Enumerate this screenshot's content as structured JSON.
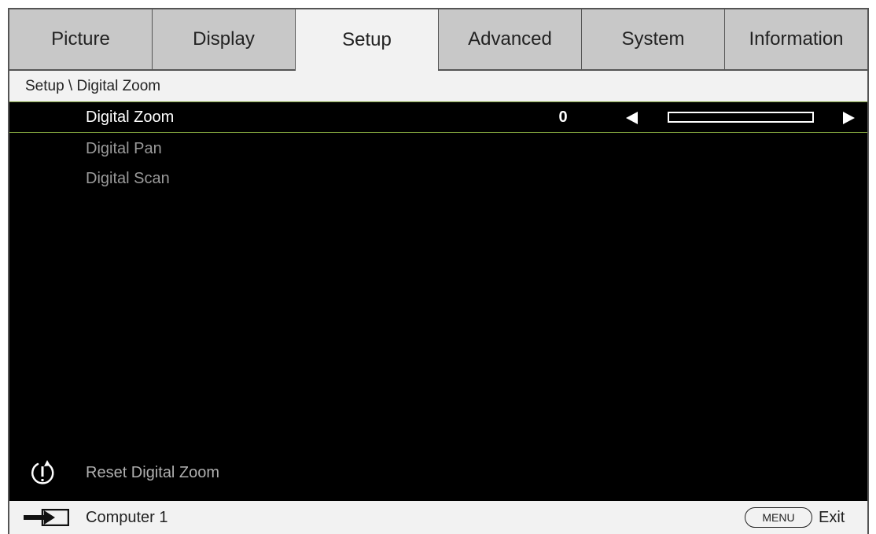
{
  "tabs": [
    {
      "label": "Picture",
      "active": false
    },
    {
      "label": "Display",
      "active": false
    },
    {
      "label": "Setup",
      "active": true
    },
    {
      "label": "Advanced",
      "active": false
    },
    {
      "label": "System",
      "active": false
    },
    {
      "label": "Information",
      "active": false
    }
  ],
  "breadcrumb": "Setup \\ Digital Zoom",
  "menu": {
    "items": [
      {
        "label": "Digital Zoom",
        "value": "0",
        "selected": true,
        "slider_fraction": 0
      },
      {
        "label": "Digital Pan",
        "selected": false
      },
      {
        "label": "Digital Scan",
        "selected": false
      }
    ],
    "reset_label": "Reset Digital Zoom"
  },
  "status": {
    "source": "Computer 1",
    "menu_button": "MENU",
    "exit": "Exit"
  },
  "colors": {
    "panel_bg": "#000000",
    "tab_bg": "#c8c8c8",
    "tab_active_bg": "#f2f2f2",
    "selection_border": "#7a9a3a"
  },
  "icons": {
    "reset": "reset-icon",
    "input_source": "input-source-icon",
    "left_arrow": "left-arrow-icon",
    "right_arrow": "right-arrow-icon"
  }
}
